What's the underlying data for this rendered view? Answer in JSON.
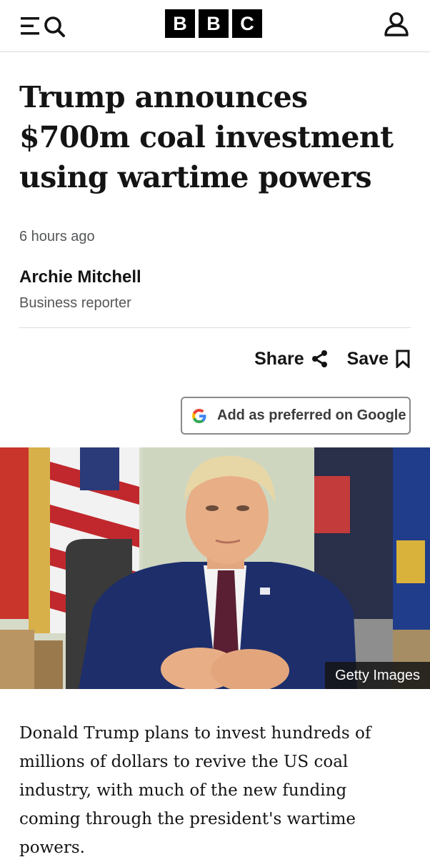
{
  "header": {
    "logo_letters": [
      "B",
      "B",
      "C"
    ],
    "menu_icon": "menu-icon",
    "search_icon": "search-icon",
    "account_icon": "account-icon"
  },
  "article": {
    "headline": "Trump announces $700m coal investment using wartime powers",
    "timestamp": "6 hours ago",
    "author": "Archie Mitchell",
    "author_role": "Business reporter",
    "share_label": "Share",
    "save_label": "Save",
    "google_button_label": "Add as preferred on Google",
    "image_credit": "Getty Images",
    "body": "Donald Trump plans to invest hundreds of millions of dollars to revive the US coal industry, with much of the new funding coming through the president's wartime powers."
  },
  "colors": {
    "text": "#141414",
    "secondary_text": "#545658",
    "logo_bg": "#000000",
    "divider": "#dcdcdc"
  }
}
